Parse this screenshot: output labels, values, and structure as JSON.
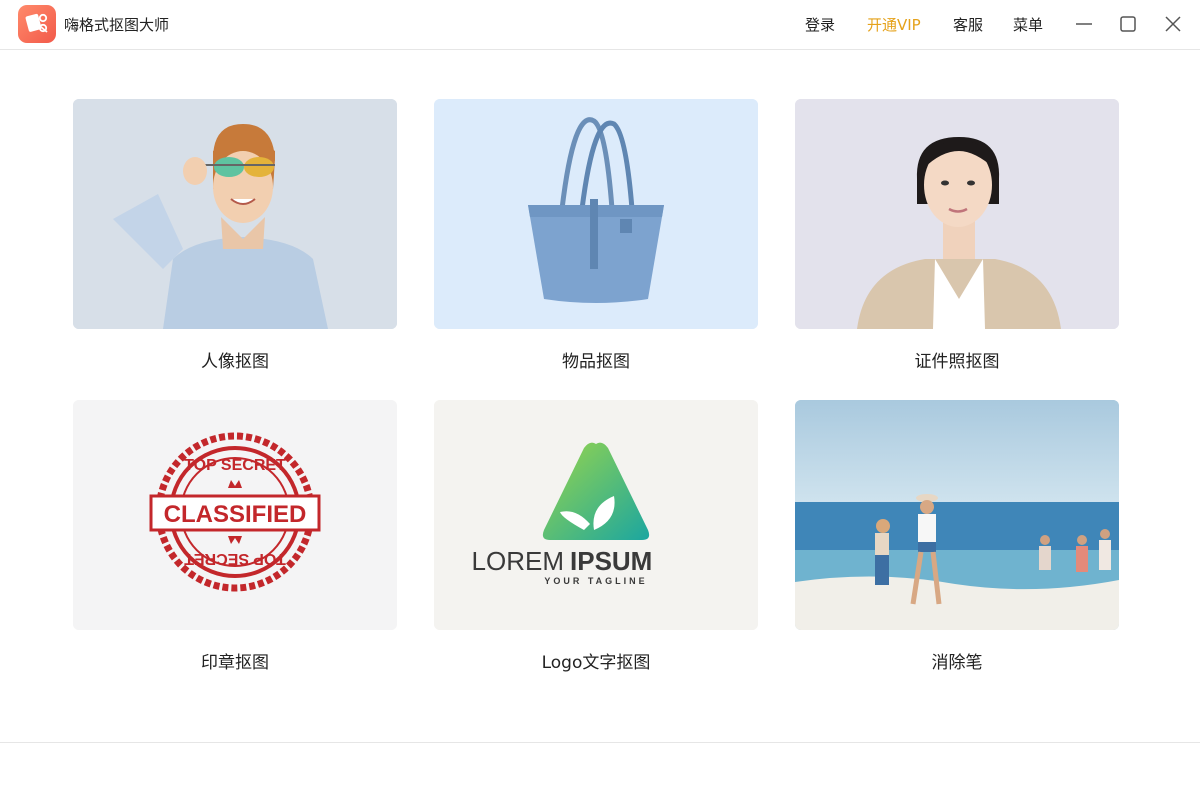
{
  "app": {
    "title": "嗨格式抠图大师"
  },
  "header": {
    "login_label": "登录",
    "vip_label": "开通VIP",
    "service_label": "客服",
    "menu_label": "菜单"
  },
  "colors": {
    "accent_vip": "#e5a21b",
    "logo": "#f25a4a"
  },
  "cards": [
    {
      "label": "人像抠图"
    },
    {
      "label": "物品抠图"
    },
    {
      "label": "证件照抠图"
    },
    {
      "label": "印章抠图",
      "stamp": {
        "top": "TOP SECRET",
        "main": "CLASSIFIED",
        "bottom": "TOP SECRET"
      }
    },
    {
      "label": "Logo文字抠图",
      "logo": {
        "main_a": "LOREM",
        "main_b": "IPSUM",
        "tagline": "YOUR TAGLINE"
      }
    },
    {
      "label": "消除笔"
    }
  ]
}
